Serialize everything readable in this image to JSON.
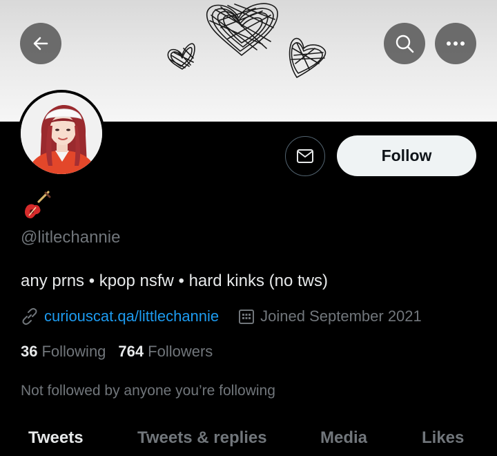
{
  "header": {
    "back_icon": "arrow-left-icon",
    "search_icon": "search-icon",
    "more_icon": "more-horizontal-icon",
    "button_bg": "#5a5a5a"
  },
  "profile": {
    "emoji": "🎸",
    "handle": "@litlechannie",
    "bio": "any prns • kpop nsfw • hard kinks (no tws)",
    "link": "curiouscat.qa/littlechannie",
    "joined": "Joined September 2021",
    "following_count": "36",
    "following_label": "Following",
    "followers_count": "764",
    "followers_label": "Followers",
    "not_followed": "Not followed by anyone you’re following"
  },
  "actions": {
    "message_icon": "envelope-icon",
    "follow_label": "Follow"
  },
  "tabs": [
    {
      "label": "Tweets",
      "active": true
    },
    {
      "label": "Tweets & replies",
      "active": false
    },
    {
      "label": "Media",
      "active": false
    },
    {
      "label": "Likes",
      "active": false
    }
  ],
  "colors": {
    "background": "#000000",
    "text": "#e7e9ea",
    "muted": "#71767b",
    "link": "#1d9bf0",
    "follow_bg": "#eff3f4"
  }
}
